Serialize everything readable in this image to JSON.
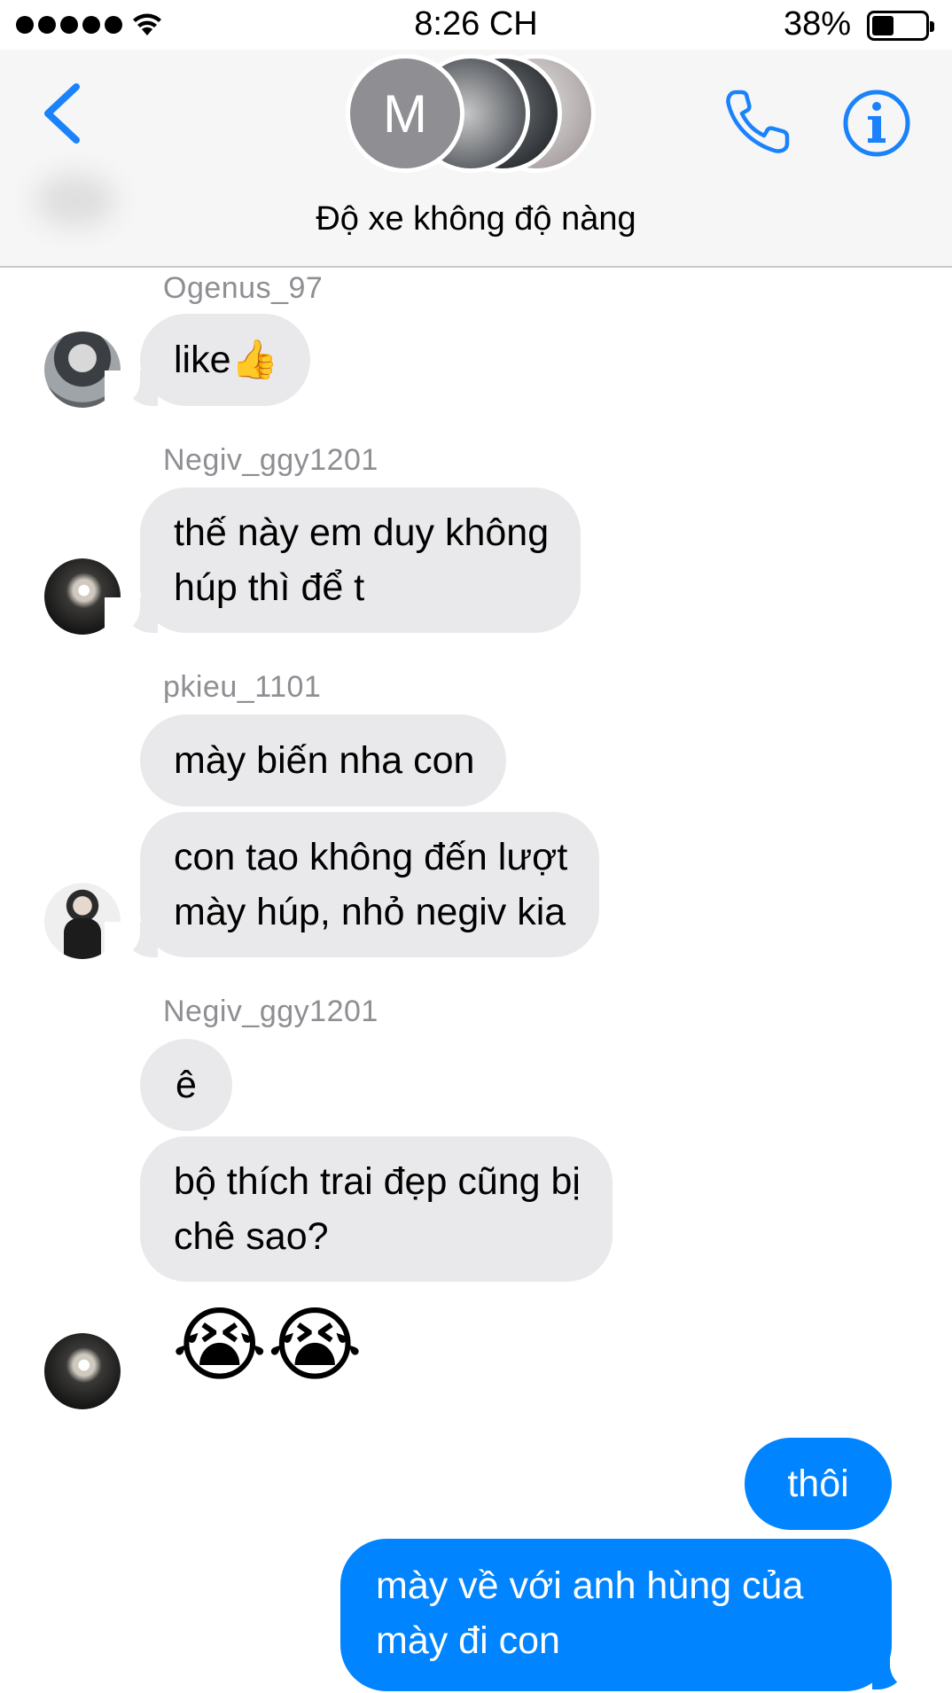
{
  "status_bar": {
    "time": "8:26 CH",
    "battery": "38%",
    "battery_level": 0.38,
    "signal_bars": 5
  },
  "header": {
    "avatar_initial": "M",
    "group_name": "Độ xe không độ nàng",
    "icons": [
      "back-chevron-icon",
      "phone-icon",
      "info-icon"
    ],
    "accent_color": "#1a82fb"
  },
  "messages": [
    {
      "sender": "Ogenus_97",
      "lines": [
        "like👍"
      ],
      "direction": "incoming"
    },
    {
      "sender": "Negiv_ggy1201",
      "lines": [
        "thế này em duy không",
        "húp thì để t"
      ],
      "direction": "incoming"
    },
    {
      "sender": "pkieu_1101",
      "lines": [
        "mày biến nha con"
      ],
      "direction": "incoming"
    },
    {
      "sender": "pkieu_1101",
      "lines": [
        "con tao không đến lượt",
        "mày húp, nhỏ negiv kia"
      ],
      "direction": "incoming"
    },
    {
      "sender": "Negiv_ggy1201",
      "lines": [
        "ê"
      ],
      "direction": "incoming"
    },
    {
      "sender": "Negiv_ggy1201",
      "lines": [
        "bộ thích trai đẹp cũng bị",
        "chê sao?"
      ],
      "direction": "incoming"
    },
    {
      "sender": "Negiv_ggy1201",
      "lines": [
        "😭😭"
      ],
      "direction": "incoming"
    },
    {
      "sender": "",
      "lines": [
        "thôi"
      ],
      "direction": "outgoing"
    },
    {
      "sender": "",
      "lines": [
        "mày về với anh hùng của",
        "mày đi con"
      ],
      "direction": "outgoing"
    }
  ],
  "colors": {
    "incoming_bubble": "#e9e9eb",
    "outgoing_bubble": "#0084ff",
    "sender_name": "#8e8e93"
  }
}
